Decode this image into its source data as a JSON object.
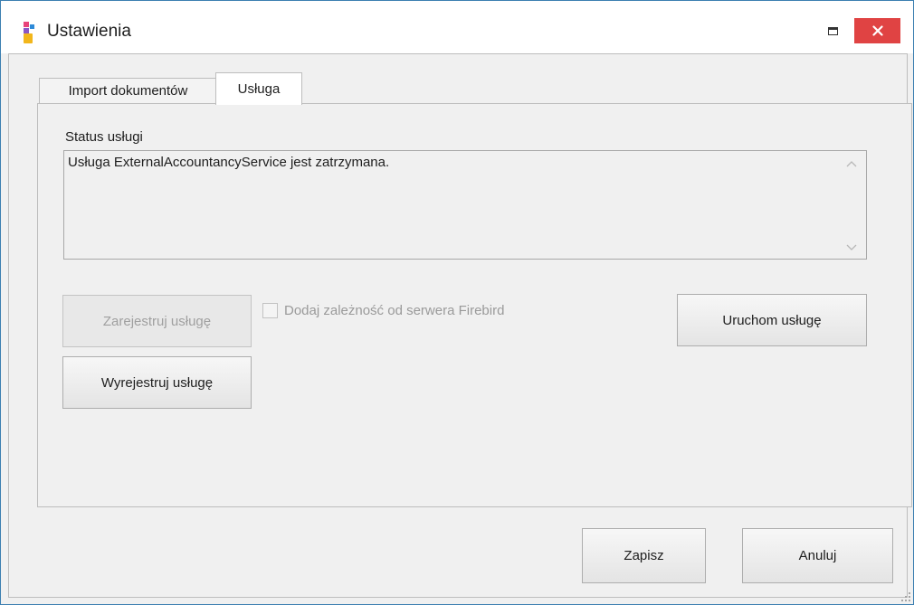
{
  "window": {
    "title": "Ustawienia",
    "icon": "app-blocks-icon",
    "close_icon": "close-icon",
    "maximize_icon": "maximize-icon",
    "accent_close": "#e04343",
    "border_color": "#3c7fb1"
  },
  "tabs": [
    {
      "label": "Import dokumentów",
      "active": false
    },
    {
      "label": "Usługa",
      "active": true
    }
  ],
  "service": {
    "status_label": "Status usługi",
    "status_text": "Usługa ExternalAccountancyService jest zatrzymana.",
    "register_label": "Zarejestruj usługę",
    "register_enabled": false,
    "dependency_label": "Dodaj zależność od serwera Firebird",
    "dependency_checked": false,
    "dependency_enabled": false,
    "unregister_label": "Wyrejestruj usługę",
    "start_label": "Uruchom usługę"
  },
  "footer": {
    "save_label": "Zapisz",
    "cancel_label": "Anuluj"
  }
}
